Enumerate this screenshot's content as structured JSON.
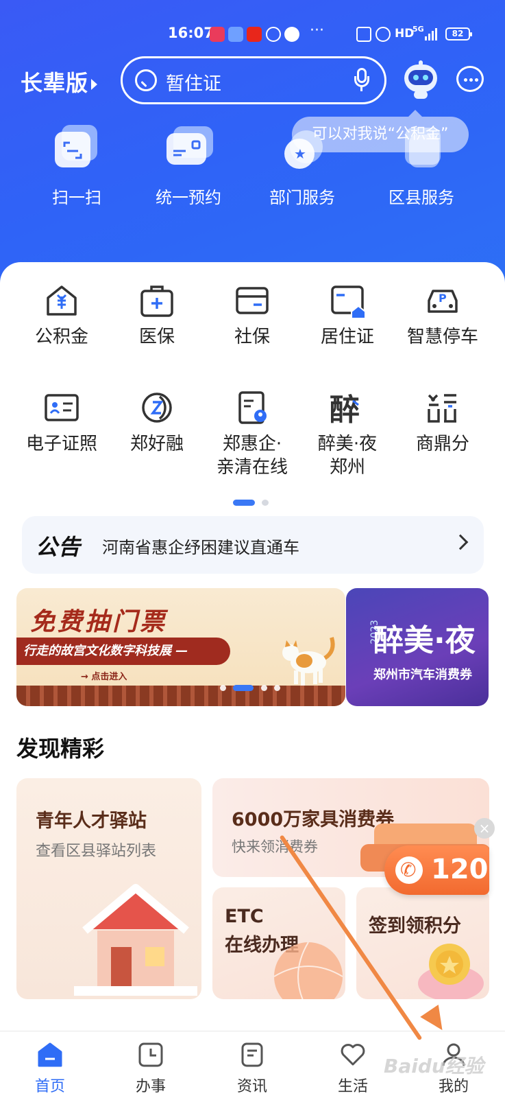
{
  "status_bar": {
    "time": "16:07",
    "indicators": [
      "HD",
      "5G"
    ],
    "battery": "82"
  },
  "header": {
    "elder_mode_label": "长辈版",
    "search_placeholder": "暂住证",
    "assistant_tip": "可以对我说“公积金”"
  },
  "quick_actions": [
    {
      "label": "扫一扫",
      "icon": "scan-icon"
    },
    {
      "label": "统一预约",
      "icon": "appointment-card-icon"
    },
    {
      "label": "部门服务",
      "icon": "department-icon"
    },
    {
      "label": "区县服务",
      "icon": "district-icon"
    }
  ],
  "services": [
    {
      "label": "公积金",
      "icon": "housing-fund-icon"
    },
    {
      "label": "医保",
      "icon": "medical-kit-icon"
    },
    {
      "label": "社保",
      "icon": "social-security-card-icon"
    },
    {
      "label": "居住证",
      "icon": "residence-permit-icon"
    },
    {
      "label": "智慧停车",
      "icon": "parking-car-icon"
    },
    {
      "label": "电子证照",
      "icon": "id-card-icon"
    },
    {
      "label": "郑好融",
      "icon": "finance-coin-icon"
    },
    {
      "label": "郑惠企·\n亲清在线",
      "icon": "enterprise-document-icon"
    },
    {
      "label": "醉美·夜\n郑州",
      "icon": "night-zhengzhou-icon"
    },
    {
      "label": "商鼎分",
      "icon": "shangding-icon"
    }
  ],
  "notice": {
    "tag_a": "公",
    "tag_b": "告",
    "text": "河南省惠企纾困建议直通车"
  },
  "banners": {
    "main_title": "免费抽门票",
    "main_subtitle": "行走的故宫文化数字科技展 —",
    "main_enter": "→ 点击进入",
    "side_title": "醉美·夜",
    "side_year": "2023",
    "side_subtitle": "郑州市汽车消费券"
  },
  "discover": {
    "title": "发现精彩",
    "tiles": [
      {
        "title": "青年人才驿站",
        "subtitle": "查看区县驿站列表"
      },
      {
        "title": "6000万家具消费券",
        "subtitle": "快来领消费券"
      },
      {
        "title": "ETC\n在线办理",
        "subtitle": ""
      },
      {
        "title": "签到领积分",
        "subtitle": ""
      }
    ]
  },
  "floating_button": {
    "label": "120",
    "close": "×"
  },
  "tabbar": [
    {
      "label": "首页",
      "icon": "home-icon",
      "active": true
    },
    {
      "label": "办事",
      "icon": "clock-icon",
      "active": false
    },
    {
      "label": "资讯",
      "icon": "news-icon",
      "active": false
    },
    {
      "label": "生活",
      "icon": "heart-icon",
      "active": false
    },
    {
      "label": "我的",
      "icon": "profile-icon",
      "active": false
    }
  ],
  "watermark": "Baidu经验",
  "colors": {
    "primary": "#2f6df6",
    "hero": "#3a5af5",
    "accent_orange": "#f26a2f",
    "annotation_arrow": "#f08844"
  }
}
